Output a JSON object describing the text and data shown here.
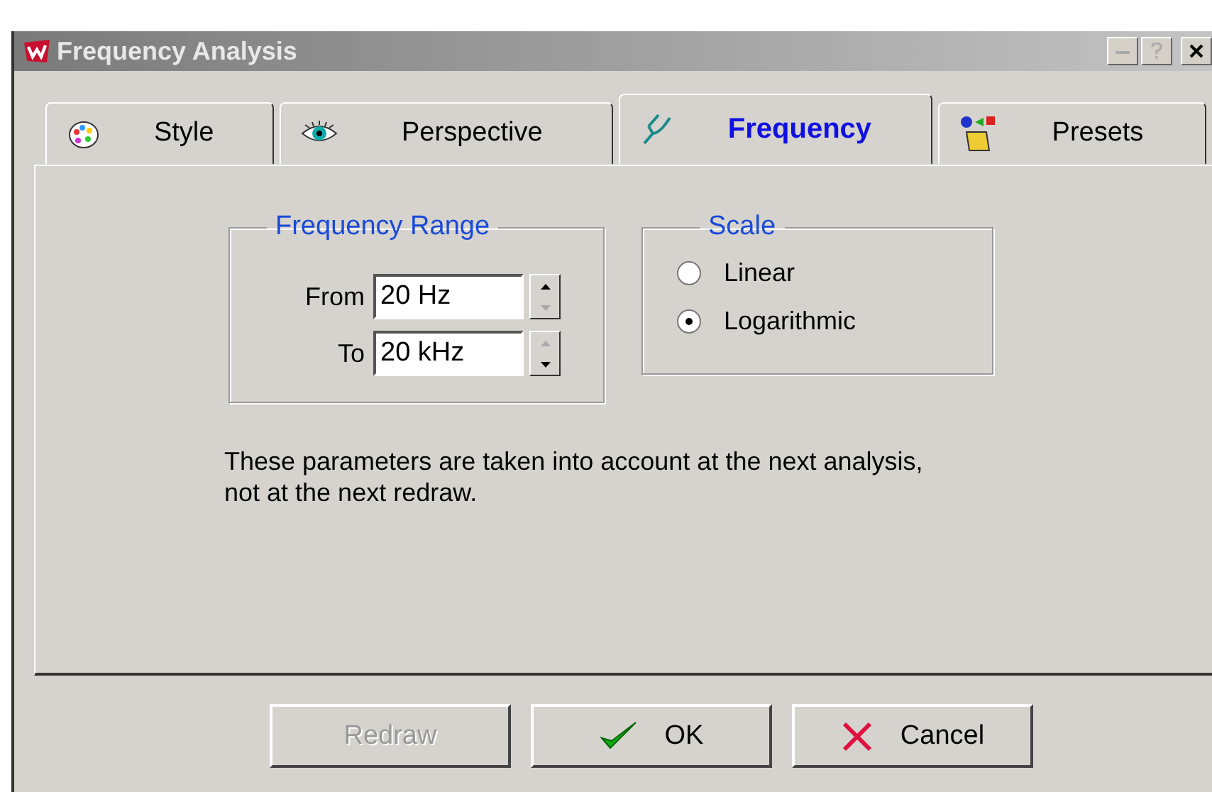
{
  "window": {
    "title": "Frequency Analysis"
  },
  "tabs": [
    {
      "label": "Style",
      "kind": "palette",
      "selected": false
    },
    {
      "label": "Perspective",
      "kind": "eye",
      "selected": false
    },
    {
      "label": "Frequency",
      "kind": "fork",
      "selected": true
    },
    {
      "label": "Presets",
      "kind": "shapes",
      "selected": false
    }
  ],
  "frequency_range": {
    "title": "Frequency Range",
    "fields": [
      {
        "label": "From",
        "value": "20 Hz",
        "up_disabled": false,
        "down_disabled": true
      },
      {
        "label": "To",
        "value": "20 kHz",
        "up_disabled": true,
        "down_disabled": false
      }
    ]
  },
  "scale": {
    "title": "Scale",
    "options": [
      {
        "label": "Linear",
        "selected": false
      },
      {
        "label": "Logarithmic",
        "selected": true
      }
    ]
  },
  "note": "These parameters are taken into account at the next analysis, not at the next redraw.",
  "buttons": [
    {
      "label": "Redraw",
      "kind": "plain",
      "disabled": true
    },
    {
      "label": "OK",
      "kind": "check",
      "disabled": false
    },
    {
      "label": "Cancel",
      "kind": "cross",
      "disabled": false
    }
  ]
}
